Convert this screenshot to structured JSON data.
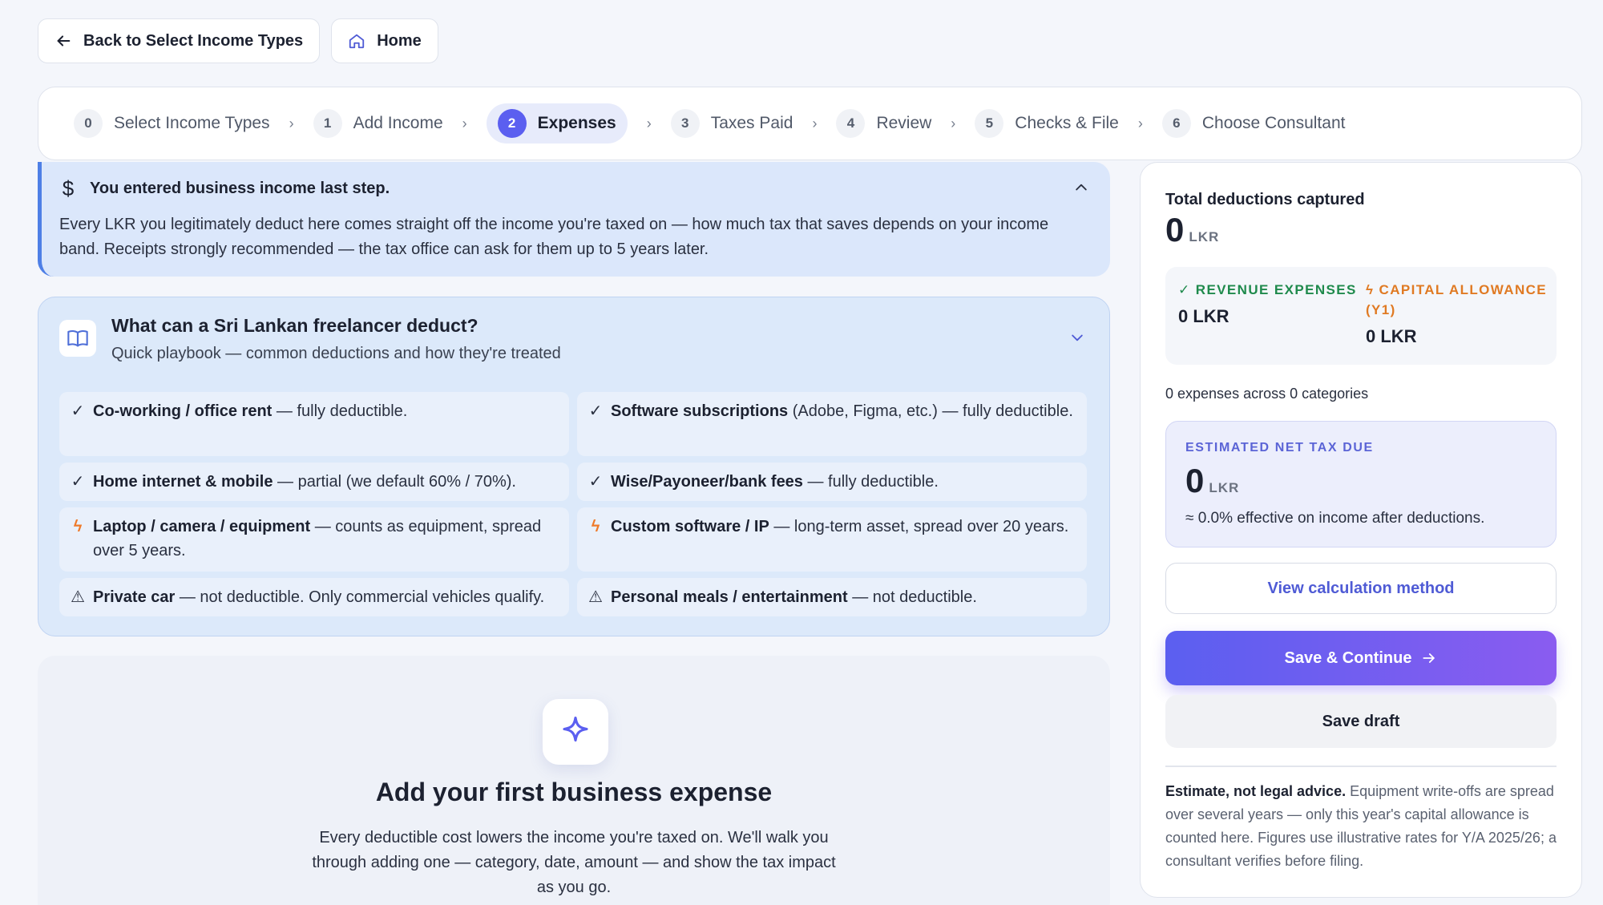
{
  "topbar": {
    "back_label": "Back to Select Income Types",
    "home_label": "Home"
  },
  "steps": [
    {
      "num": "0",
      "label": "Select Income Types",
      "active": false
    },
    {
      "num": "1",
      "label": "Add Income",
      "active": false
    },
    {
      "num": "2",
      "label": "Expenses",
      "active": true
    },
    {
      "num": "3",
      "label": "Taxes Paid",
      "active": false
    },
    {
      "num": "4",
      "label": "Review",
      "active": false
    },
    {
      "num": "5",
      "label": "Checks & File",
      "active": false
    },
    {
      "num": "6",
      "label": "Choose Consultant",
      "active": false
    }
  ],
  "step_separator": "›",
  "notice": {
    "icon": "$",
    "title": "You entered business income last step.",
    "body": "Every LKR you legitimately deduct here comes straight off the income you're taxed on — how much tax that saves depends on your income band. Receipts strongly recommended — the tax office can ask for them up to 5 years later."
  },
  "playbook": {
    "title": "What can a Sri Lankan freelancer deduct?",
    "subtitle": "Quick playbook — common deductions and how they're treated",
    "items": [
      {
        "mark": "✓",
        "kind": "check",
        "bold": "Co-working / office rent",
        "rest": " — fully deductible."
      },
      {
        "mark": "✓",
        "kind": "check",
        "bold": "Software subscriptions",
        "rest": " (Adobe, Figma, etc.) — fully deductible."
      },
      {
        "mark": "✓",
        "kind": "check",
        "bold": "Home internet & mobile",
        "rest": " — partial (we default 60% / 70%)."
      },
      {
        "mark": "✓",
        "kind": "check",
        "bold": "Wise/Payoneer/bank fees",
        "rest": " — fully deductible."
      },
      {
        "mark": "ϟ",
        "kind": "bolt",
        "bold": "Laptop / camera / equipment",
        "rest": " — counts as equipment, spread over 5 years."
      },
      {
        "mark": "ϟ",
        "kind": "bolt",
        "bold": "Custom software / IP",
        "rest": " — long-term asset, spread over 20 years."
      },
      {
        "mark": "⚠",
        "kind": "warn",
        "bold": "Private car",
        "rest": " — not deductible. Only commercial vehicles qualify."
      },
      {
        "mark": "⚠",
        "kind": "warn",
        "bold": "Personal meals / entertainment",
        "rest": " — not deductible."
      }
    ]
  },
  "empty_state": {
    "title": "Add your first business expense",
    "text": "Every deductible cost lowers the income you're taxed on. We'll walk you through adding one — category, date, amount — and show the tax impact as you go."
  },
  "summary": {
    "total_label": "Total deductions captured",
    "total_value": "0",
    "currency": "LKR",
    "revenue_label": "✓ REVENUE EXPENSES",
    "revenue_value": "0 LKR",
    "capital_label": "ϟ CAPITAL ALLOWANCE (Y1)",
    "capital_value": "0 LKR",
    "count_text": "0 expenses across 0 categories",
    "net_label": "ESTIMATED NET TAX DUE",
    "net_value": "0",
    "effective_text": "≈ 0.0% effective on income after deductions.",
    "view_method_label": "View calculation method",
    "save_continue_label": "Save & Continue",
    "save_draft_label": "Save draft",
    "disclaimer_bold": "Estimate, not legal advice.",
    "disclaimer_rest": " Equipment write-offs are spread over several years — only this year's capital allowance is counted here. Figures use illustrative rates for Y/A 2025/26; a consultant verifies before filing."
  },
  "colors": {
    "accent": "#5b5ff0",
    "revenue": "#1f8a4c",
    "capital": "#e07a23",
    "notice_bg": "#dbe7fb"
  }
}
